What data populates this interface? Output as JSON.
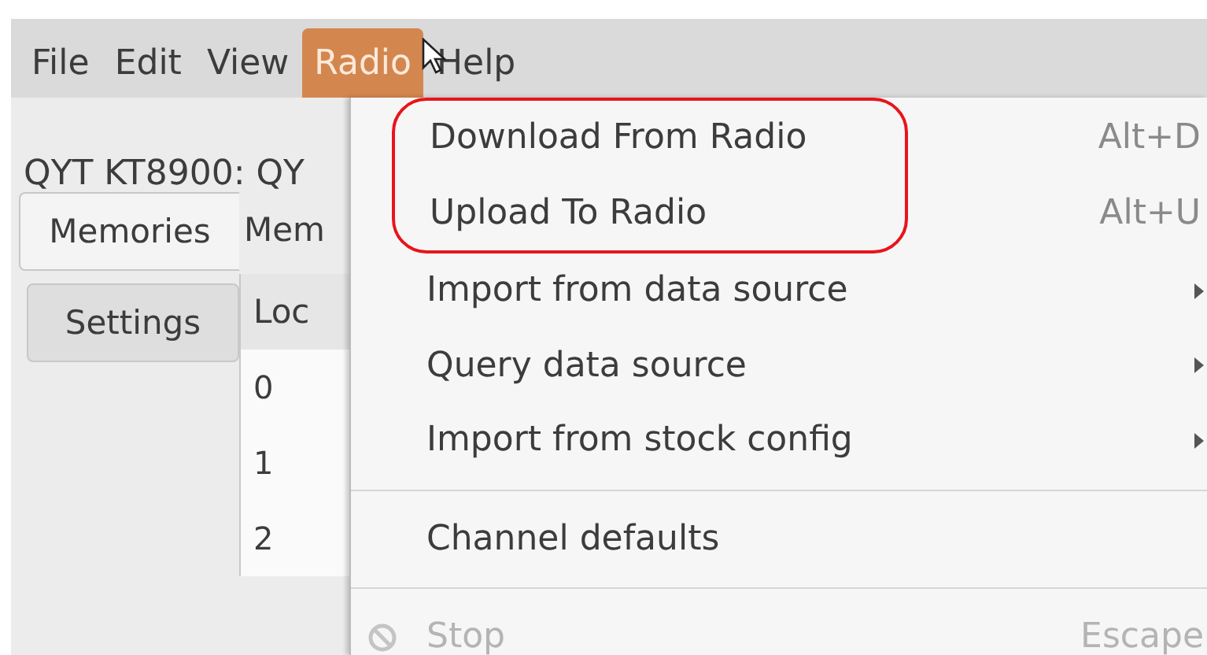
{
  "menubar": [
    {
      "label": "File",
      "selected": false
    },
    {
      "label": "Edit",
      "selected": false
    },
    {
      "label": "View",
      "selected": false
    },
    {
      "label": "Radio",
      "selected": true
    },
    {
      "label": "Help",
      "selected": false
    }
  ],
  "window": {
    "title": "QYT KT8900: QY"
  },
  "tabs": [
    {
      "label": "Memories",
      "selected": true
    },
    {
      "label": "Settings",
      "selected": false
    }
  ],
  "pane": {
    "label": "Mem"
  },
  "table": {
    "columns": [
      "Loc"
    ],
    "rows": [
      "0",
      "1",
      "2"
    ]
  },
  "menu": {
    "items": [
      {
        "kind": "item",
        "label": "Download From Radio",
        "shortcut": "Alt+D",
        "submenu": false,
        "disabled": false,
        "circled": true
      },
      {
        "kind": "item",
        "label": "Upload To Radio",
        "shortcut": "Alt+U",
        "submenu": false,
        "disabled": false,
        "circled": true
      },
      {
        "kind": "item",
        "label": "Import from data source",
        "submenu": true,
        "disabled": false,
        "circled": false
      },
      {
        "kind": "item",
        "label": "Query data source",
        "submenu": true,
        "disabled": false,
        "circled": false
      },
      {
        "kind": "item",
        "label": "Import from stock config",
        "submenu": true,
        "disabled": false,
        "circled": false
      },
      {
        "kind": "separator"
      },
      {
        "kind": "item",
        "label": "Channel defaults",
        "submenu": false,
        "disabled": false,
        "circled": false
      },
      {
        "kind": "separator"
      },
      {
        "kind": "icon-item",
        "label": "Stop",
        "shortcut": "Escape",
        "submenu": false,
        "disabled": true,
        "circled": false
      }
    ]
  }
}
